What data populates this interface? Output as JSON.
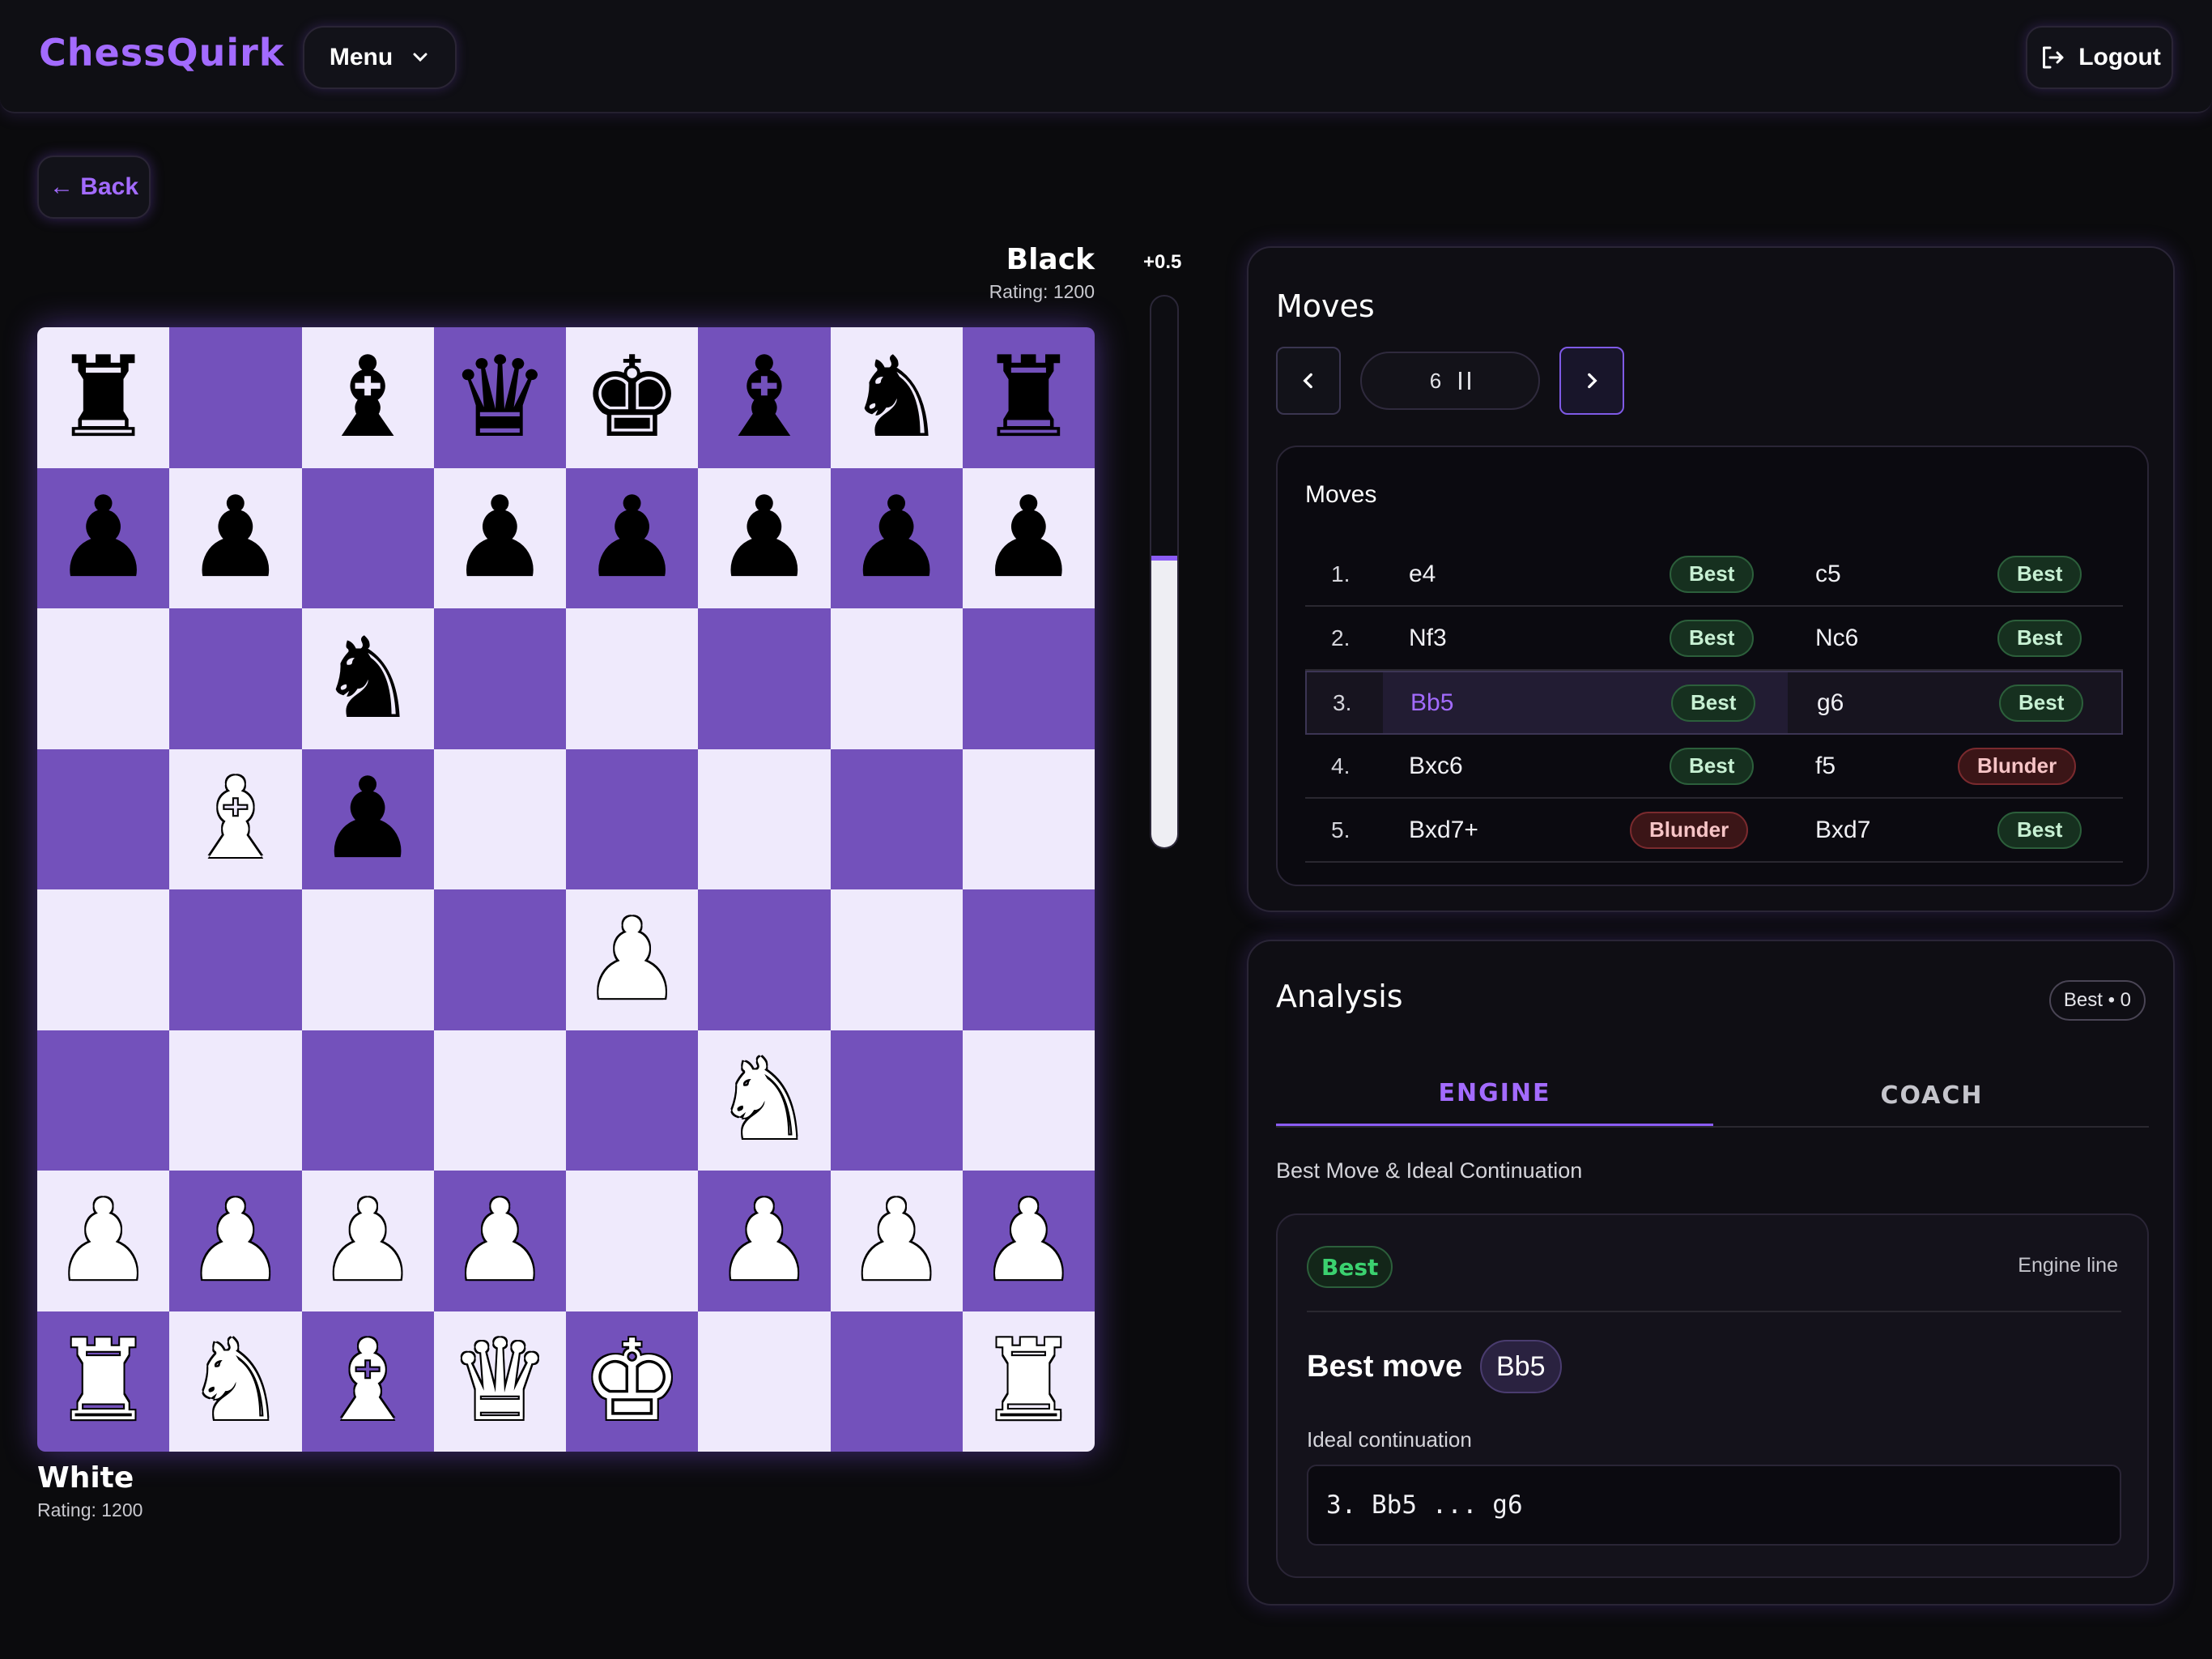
{
  "app": {
    "title": "ChessQuirk"
  },
  "header": {
    "menu_label": "Menu",
    "logout_label": "Logout"
  },
  "back": {
    "label": "← Back"
  },
  "players": {
    "black": {
      "name": "Black",
      "rating": "Rating: 1200"
    },
    "white": {
      "name": "White",
      "rating": "Rating: 1200"
    }
  },
  "eval": {
    "value": "+0.5",
    "white_share": 0.53
  },
  "board": {
    "ranks": [
      [
        "br",
        "",
        "bb",
        "bq",
        "bk",
        "bb",
        "bn",
        "br"
      ],
      [
        "bp",
        "bp",
        "",
        "bp",
        "bp",
        "bp",
        "bp",
        "bp"
      ],
      [
        "",
        "",
        "bn",
        "",
        "",
        "",
        "",
        ""
      ],
      [
        "",
        "wb",
        "bp",
        "",
        "",
        "",
        "",
        ""
      ],
      [
        "",
        "",
        "",
        "",
        "wp",
        "",
        "",
        ""
      ],
      [
        "",
        "",
        "",
        "",
        "",
        "wn",
        "",
        ""
      ],
      [
        "wp",
        "wp",
        "wp",
        "wp",
        "",
        "wp",
        "wp",
        "wp"
      ],
      [
        "wr",
        "wn",
        "wb",
        "wq",
        "wk",
        "",
        "",
        "wr"
      ]
    ]
  },
  "moves_panel": {
    "title": "Moves",
    "counter_value": "6",
    "inner_title": "Moves",
    "rows": [
      {
        "num": "1.",
        "white": "e4",
        "white_tag": "Best",
        "black": "c5",
        "black_tag": "Best"
      },
      {
        "num": "2.",
        "white": "Nf3",
        "white_tag": "Best",
        "black": "Nc6",
        "black_tag": "Best"
      },
      {
        "num": "3.",
        "white": "Bb5",
        "white_tag": "Best",
        "black": "g6",
        "black_tag": "Best"
      },
      {
        "num": "4.",
        "white": "Bxc6",
        "white_tag": "Best",
        "black": "f5",
        "black_tag": "Blunder"
      },
      {
        "num": "5.",
        "white": "Bxd7+",
        "white_tag": "Blunder",
        "black": "Bxd7",
        "black_tag": "Best"
      }
    ]
  },
  "analysis": {
    "title": "Analysis",
    "count_chip": "Best • 0",
    "tabs": {
      "engine": "ENGINE",
      "coach": "COACH"
    },
    "subtitle": "Best Move & Ideal Continuation",
    "card": {
      "tag": "Best",
      "line_label": "Engine line",
      "best_move_label": "Best move",
      "best_move": "Bb5",
      "ideal_label": "Ideal continuation",
      "ideal_line": "3. Bb5 ... g6"
    }
  },
  "colors": {
    "accent": "#a36bff",
    "board_light": "#efeafc",
    "board_dark": "#7351bb"
  }
}
